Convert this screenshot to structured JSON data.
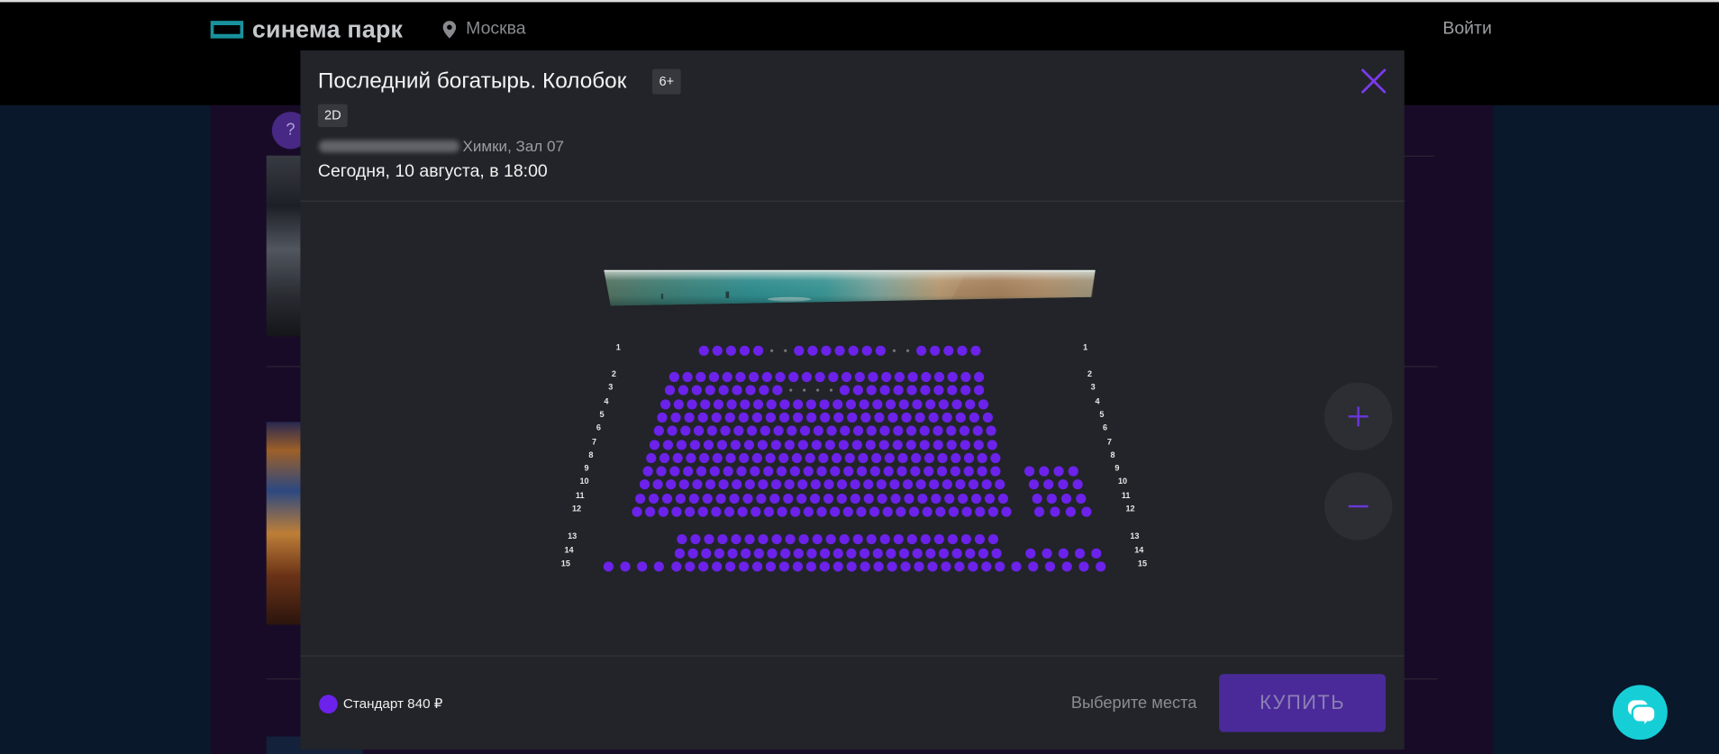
{
  "header": {
    "logo_text": "синема парк",
    "city": "Москва",
    "login": "Войти"
  },
  "background": {
    "help_badge": "?"
  },
  "session": {
    "title": "Последний богатырь. Колобок",
    "age_rating": "6+",
    "format": "2D",
    "hall": "Химки, Зал 07",
    "datetime": "Сегодня, 10 августа, в 18:00"
  },
  "seat_map": {
    "rows": [
      {
        "label": "1",
        "blocks": [
          [
            1,
            1,
            1,
            1,
            1,
            0,
            0,
            1,
            1,
            1,
            1,
            1,
            1,
            1,
            0,
            0,
            1,
            1,
            1,
            1,
            1
          ]
        ]
      },
      {
        "label": "2",
        "blocks": [
          [
            1,
            1,
            1,
            1,
            1,
            1,
            1,
            1,
            1,
            1,
            1,
            1,
            1,
            1,
            1,
            1,
            1,
            1,
            1,
            1,
            1,
            1,
            1,
            1
          ]
        ]
      },
      {
        "label": "3",
        "blocks": [
          [
            1,
            1,
            1,
            1,
            1,
            1,
            1,
            1,
            1,
            0,
            0,
            0,
            0,
            1,
            1,
            1,
            1,
            1,
            1,
            1,
            1,
            1,
            1,
            1
          ]
        ]
      },
      {
        "label": "4",
        "blocks": [
          [
            1,
            1,
            1,
            1,
            1,
            1,
            1,
            1,
            1,
            1,
            1,
            1,
            1,
            1,
            1,
            1,
            1,
            1,
            1,
            1,
            1,
            1,
            1,
            1,
            1
          ]
        ]
      },
      {
        "label": "5",
        "blocks": [
          [
            1,
            1,
            1,
            1,
            1,
            1,
            1,
            1,
            1,
            1,
            1,
            1,
            1,
            1,
            1,
            1,
            1,
            1,
            1,
            1,
            1,
            1,
            1,
            1,
            1
          ]
        ]
      },
      {
        "label": "6",
        "blocks": [
          [
            1,
            1,
            1,
            1,
            1,
            1,
            1,
            1,
            1,
            1,
            1,
            1,
            1,
            1,
            1,
            1,
            1,
            1,
            1,
            1,
            1,
            1,
            1,
            1,
            1,
            1
          ]
        ]
      },
      {
        "label": "7",
        "blocks": [
          [
            1,
            1,
            1,
            1,
            1,
            1,
            1,
            1,
            1,
            1,
            1,
            1,
            1,
            1,
            1,
            1,
            1,
            1,
            1,
            1,
            1,
            1,
            1,
            1,
            1,
            1
          ]
        ]
      },
      {
        "label": "8",
        "blocks": [
          [
            1,
            1,
            1,
            1,
            1,
            1,
            1,
            1,
            1,
            1,
            1,
            1,
            1,
            1,
            1,
            1,
            1,
            1,
            1,
            1,
            1,
            1,
            1,
            1,
            1,
            1,
            1
          ]
        ]
      },
      {
        "label": "9",
        "blocks": [
          [
            1,
            1,
            1,
            1,
            1,
            1,
            1,
            1,
            1,
            1,
            1,
            1,
            1,
            1,
            1,
            1,
            1,
            1,
            1,
            1,
            1,
            1,
            1,
            1,
            1,
            1,
            1
          ],
          [
            1,
            1,
            1,
            1
          ]
        ]
      },
      {
        "label": "10",
        "blocks": [
          [
            1,
            1,
            1,
            1,
            1,
            1,
            1,
            1,
            1,
            1,
            1,
            1,
            1,
            1,
            1,
            1,
            1,
            1,
            1,
            1,
            1,
            1,
            1,
            1,
            1,
            1,
            1,
            1
          ],
          [
            1,
            1,
            1,
            1
          ]
        ]
      },
      {
        "label": "11",
        "blocks": [
          [
            1,
            1,
            1,
            1,
            1,
            1,
            1,
            1,
            1,
            1,
            1,
            1,
            1,
            1,
            1,
            1,
            1,
            1,
            1,
            1,
            1,
            1,
            1,
            1,
            1,
            1,
            1,
            1
          ],
          [
            1,
            1,
            1,
            1
          ]
        ]
      },
      {
        "label": "12",
        "blocks": [
          [
            1,
            1,
            1,
            1,
            1,
            1,
            1,
            1,
            1,
            1,
            1,
            1,
            1,
            1,
            1,
            1,
            1,
            1,
            1,
            1,
            1,
            1,
            1,
            1,
            1,
            1,
            1,
            1,
            1
          ],
          [
            1,
            1,
            1,
            1
          ]
        ]
      },
      {
        "label": "13",
        "blocks": [
          [
            1,
            1,
            1,
            1,
            1,
            1,
            1,
            1,
            1,
            1,
            1,
            1,
            1,
            1,
            1,
            1,
            1,
            1,
            1,
            1,
            1,
            1,
            1,
            1
          ]
        ]
      },
      {
        "label": "14",
        "blocks": [
          [
            1,
            1,
            1,
            1,
            1,
            1,
            1,
            1,
            1,
            1,
            1,
            1,
            1,
            1,
            1,
            1,
            1,
            1,
            1,
            1,
            1,
            1,
            1,
            1,
            1
          ],
          [
            1,
            1,
            1,
            1,
            1
          ]
        ]
      },
      {
        "label": "15",
        "blocks": [
          [
            1,
            1,
            1,
            1
          ],
          [
            1,
            1,
            1,
            1,
            1,
            1,
            1,
            1,
            1,
            1,
            1,
            1,
            1,
            1,
            1,
            1,
            1,
            1,
            1,
            1,
            1,
            1,
            1,
            1,
            1
          ],
          [
            1,
            1,
            1,
            1,
            1,
            1
          ]
        ]
      }
    ]
  },
  "legend": [
    {
      "label": "Стандарт 840 ₽",
      "color": "#6c22ea"
    }
  ],
  "footer": {
    "hint": "Выберите места",
    "buy_label": "КУПИТЬ"
  },
  "colors": {
    "accent": "#6c22ea",
    "close_icon": "#7c3aed",
    "buy_button": "#4a2a98",
    "chat_button": "#16cfd6",
    "logo": "#1998a4"
  },
  "icons": {
    "logo": "cinema-logo-icon",
    "city": "location-pin-icon",
    "close": "close-icon",
    "zoom_in": "plus-icon",
    "zoom_out": "minus-icon",
    "chat": "chat-icon"
  }
}
